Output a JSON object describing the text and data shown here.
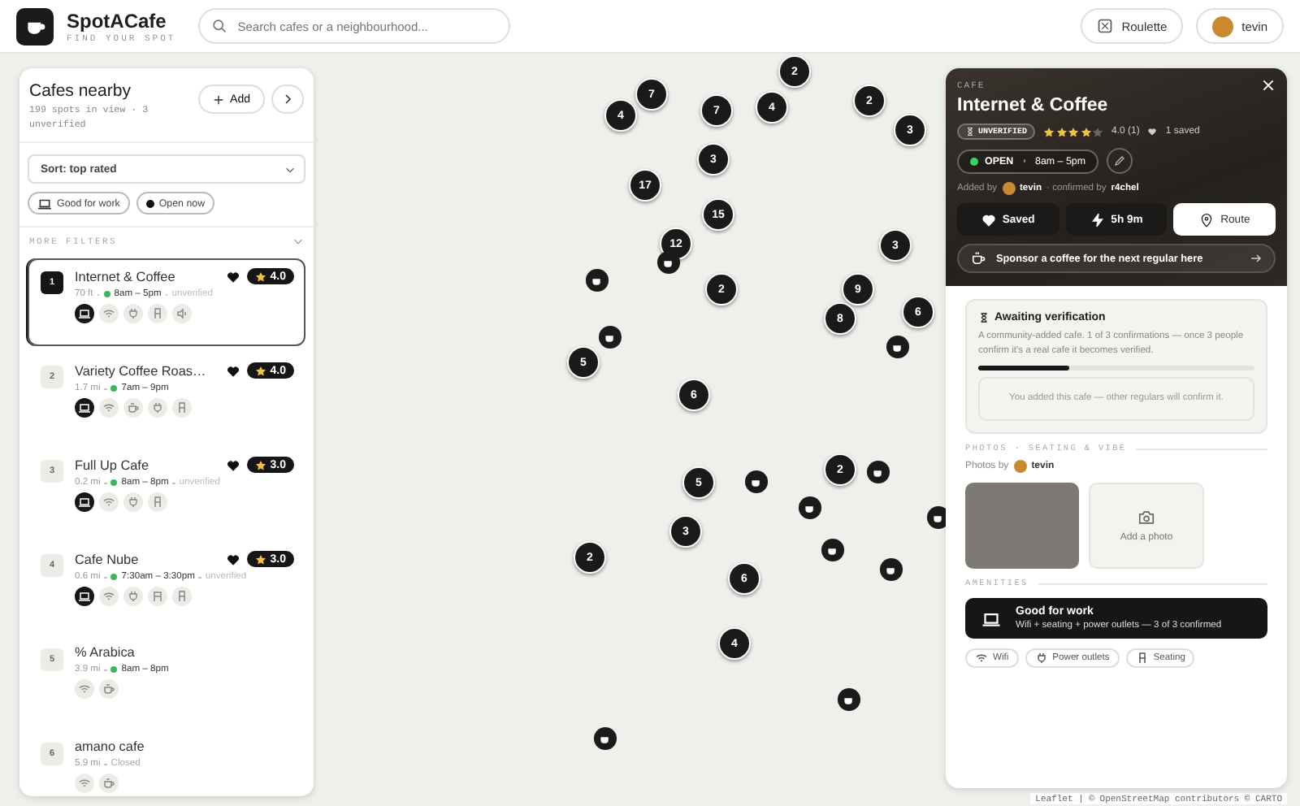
{
  "header": {
    "logo_title": "SpotACafe",
    "tagline": "FIND YOUR SPOT",
    "search": {
      "placeholder": "Search cafes or a neighbourhood..."
    },
    "roulette": "Roulette",
    "user": "tevin"
  },
  "sidebar": {
    "title": "Cafes nearby",
    "summary": "199 spots in view · 3 unverified",
    "add": "Add",
    "sort": "Sort: top rated",
    "filters": [
      {
        "label": "Good for work",
        "kind": "laptop"
      },
      {
        "label": "Open now",
        "kind": "dot"
      }
    ],
    "more_filters": "MORE FILTERS",
    "cafes": [
      {
        "rank": "1",
        "name": "Internet & Coffee",
        "favorite": true,
        "rating": "4.0",
        "distance": "70 ft",
        "hours": "8am – 5pm",
        "open": true,
        "unverified": "unverified",
        "selected": true,
        "amenities": [
          {
            "kind": "laptop",
            "on": true
          },
          {
            "kind": "wifi",
            "on": false
          },
          {
            "kind": "plug",
            "on": false
          },
          {
            "kind": "seat",
            "on": false
          },
          {
            "kind": "speaker",
            "on": false
          }
        ]
      },
      {
        "rank": "2",
        "name": "Variety Coffee Roas…",
        "favorite": true,
        "rating": "4.0",
        "distance": "1.7 mi",
        "hours": "7am – 9pm",
        "open": true,
        "selected": false,
        "amenities": [
          {
            "kind": "laptop",
            "on": true
          },
          {
            "kind": "wifi",
            "on": false
          },
          {
            "kind": "cup",
            "on": false
          },
          {
            "kind": "plug",
            "on": false
          },
          {
            "kind": "seat",
            "on": false
          }
        ]
      },
      {
        "rank": "3",
        "name": "Full Up Cafe",
        "favorite": true,
        "rating": "3.0",
        "distance": "0.2 mi",
        "hours": "8am – 8pm",
        "open": true,
        "unverified": "unverified",
        "selected": false,
        "amenities": [
          {
            "kind": "laptop",
            "on": true
          },
          {
            "kind": "wifi",
            "on": false
          },
          {
            "kind": "plug",
            "on": false
          },
          {
            "kind": "seat",
            "on": false
          }
        ]
      },
      {
        "rank": "4",
        "name": "Cafe Nube",
        "favorite": true,
        "rating": "3.0",
        "distance": "0.6 mi",
        "hours": "7:30am – 3:30pm",
        "open": true,
        "unverified": "unverified",
        "selected": false,
        "amenities": [
          {
            "kind": "laptop",
            "on": true
          },
          {
            "kind": "wifi",
            "on": false
          },
          {
            "kind": "plug",
            "on": false
          },
          {
            "kind": "chair",
            "on": false
          },
          {
            "kind": "seat",
            "on": false
          }
        ]
      },
      {
        "rank": "5",
        "name": "% Arabica",
        "favorite": false,
        "distance": "3.9 mi",
        "hours": "8am – 8pm",
        "open": true,
        "selected": false,
        "amenities": [
          {
            "kind": "wifi",
            "on": false
          },
          {
            "kind": "cup",
            "on": false
          }
        ]
      },
      {
        "rank": "6",
        "name": "amano cafe",
        "favorite": false,
        "distance": "5.9 mi",
        "hours": "Closed",
        "open": false,
        "selected": false,
        "amenities": [
          {
            "kind": "wifi",
            "on": false
          },
          {
            "kind": "cup",
            "on": false
          }
        ]
      }
    ]
  },
  "map": {
    "clusters": [
      "2",
      "7",
      "2",
      "4",
      "7",
      "4",
      "3",
      "3",
      "17",
      "15",
      "3",
      "12",
      "2",
      "9",
      "8",
      "6",
      "5",
      "6",
      "5",
      "2",
      "3",
      "2",
      "6",
      "4"
    ],
    "attribution": "Leaflet | © OpenStreetMap contributors © CARTO"
  },
  "detail": {
    "category": "CAFE",
    "name": "Internet & Coffee",
    "status_badge": "UNVERIFIED",
    "stars": 4,
    "rating": "4.0 (1)",
    "saved_count": "1 saved",
    "open": true,
    "open_label": "OPEN",
    "hours": "8am – 5pm",
    "added_by": "Added by",
    "added_user": "tevin",
    "confirmed_by": "· confirmed by",
    "confirmer": "r4chel",
    "actions": [
      {
        "label": "Saved",
        "kind": "heart",
        "primary": false
      },
      {
        "label": "5h 9m",
        "kind": "bolt",
        "primary": false
      },
      {
        "label": "Route",
        "kind": "pin",
        "primary": true
      }
    ],
    "sponsor": "Sponsor a coffee for the next regular here",
    "verification": {
      "title": "Awaiting verification",
      "text": "A community-added cafe. 1 of 3 confirmations — once 3 people confirm it's a real cafe it becomes verified.",
      "level": 0.33,
      "note": "You added this cafe — other regulars will confirm it."
    },
    "photos": {
      "heading": "PHOTOS · SEATING & VIBE",
      "by": "Photos by",
      "user": "tevin",
      "add": "Add a photo"
    },
    "amenities": {
      "heading": "AMENITIES",
      "highlight": {
        "title": "Good for work",
        "text": "Wifi + seating + power outlets — 3 of 3 confirmed"
      },
      "chips": [
        {
          "label": "Wifi",
          "kind": "wifi"
        },
        {
          "label": "Power outlets",
          "kind": "plug"
        },
        {
          "label": "Seating",
          "kind": "seat"
        }
      ]
    }
  }
}
